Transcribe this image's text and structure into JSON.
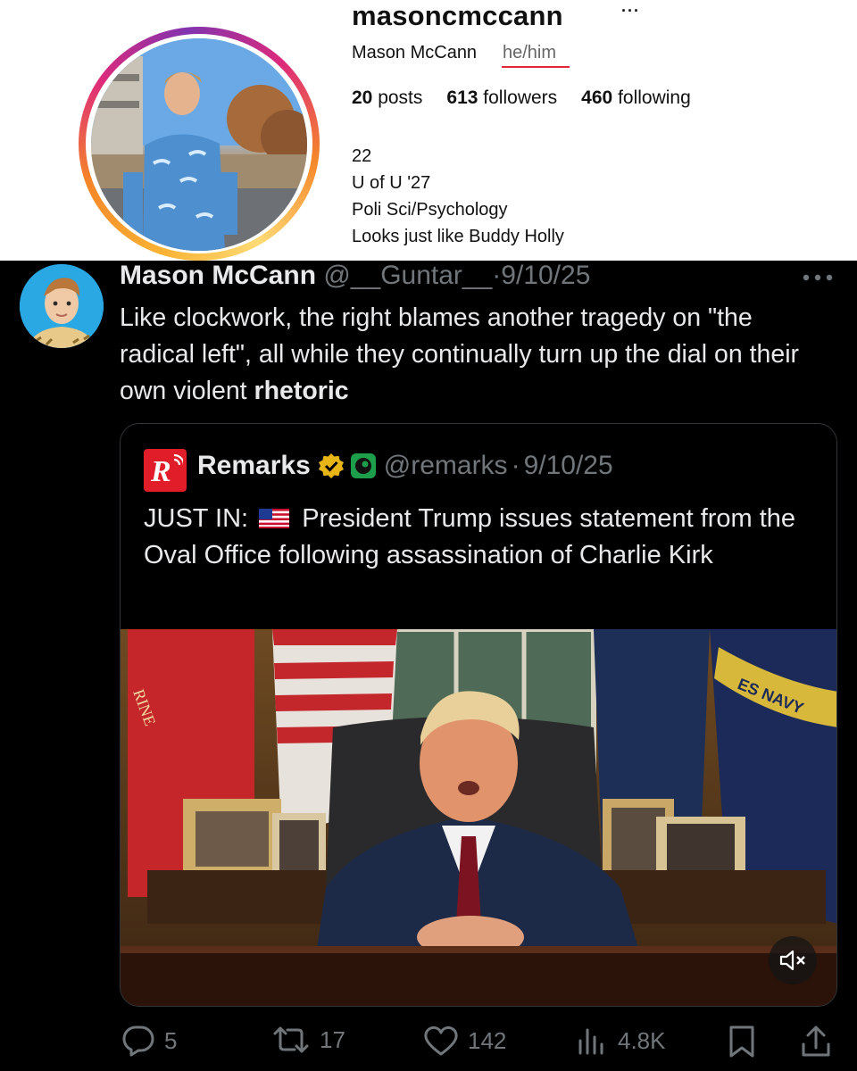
{
  "instagram": {
    "username": "masoncmccann",
    "more": "···",
    "full_name": "Mason McCann",
    "pronouns": "he/him",
    "stats": {
      "posts_count": "20",
      "posts_label": "posts",
      "followers_count": "613",
      "followers_label": "followers",
      "following_count": "460",
      "following_label": "following"
    },
    "bio": [
      "22",
      "U of U '27",
      "Poli Sci/Psychology",
      "Looks just like Buddy Holly"
    ]
  },
  "tweet": {
    "display_name": "Mason McCann",
    "handle": "@__Guntar__",
    "separator": "·",
    "date": "9/10/25",
    "text_main": "Like clockwork, the right blames another tragedy on \"the radical left\", all while they continually turn up the dial on their own violent ",
    "text_bold": "rhetoric",
    "quote": {
      "display_name": "Remarks",
      "handle": "@remarks",
      "separator": "·",
      "date": "9/10/25",
      "text_prefix": "JUST IN:",
      "text_body": "President Trump issues statement from the Oval Office following assassination of Charlie Kirk"
    },
    "actions": {
      "replies": "5",
      "reposts": "17",
      "likes": "142",
      "views": "4.8K"
    }
  },
  "icons": {
    "more": "more-icon",
    "verified": "verified-badge-icon",
    "affiliate": "affiliate-badge-icon",
    "flag": "us-flag-icon",
    "mute": "mute-icon",
    "reply": "reply-icon",
    "repost": "repost-icon",
    "like": "like-icon",
    "views": "views-icon",
    "bookmark": "bookmark-icon",
    "share": "share-icon"
  },
  "colors": {
    "x_background": "#000000",
    "x_text": "#e7e9ea",
    "x_muted": "#71767b",
    "verified_gold": "#e8b517",
    "remarks_red": "#e11d2a",
    "pronoun_underline": "#e0253b"
  }
}
